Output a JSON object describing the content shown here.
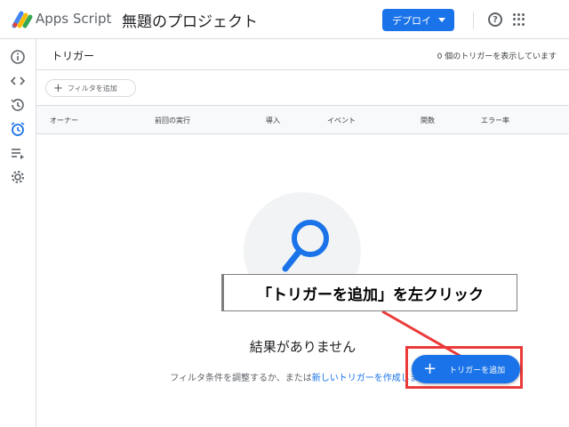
{
  "header": {
    "app_name": "Apps Script",
    "project_name": "無題のプロジェクト",
    "deploy_label": "デプロイ",
    "help_glyph": "?"
  },
  "sidebar": {
    "items": [
      {
        "name": "overview",
        "icon": "info-icon"
      },
      {
        "name": "editor",
        "icon": "code-icon"
      },
      {
        "name": "executions",
        "icon": "history-icon"
      },
      {
        "name": "triggers",
        "icon": "alarm-icon",
        "active": true
      },
      {
        "name": "executions-log",
        "icon": "playlist-icon"
      },
      {
        "name": "settings",
        "icon": "gear-icon"
      }
    ]
  },
  "page": {
    "title": "トリガー",
    "count_text": "0 個のトリガーを表示しています",
    "filter_label": "フィルタを追加",
    "columns": [
      "オーナー",
      "前回の実行",
      "導入",
      "イベント",
      "関数",
      "エラー率"
    ]
  },
  "empty_state": {
    "title": "結果がありません",
    "subtitle_prefix": "フィルタ条件を調整するか、または",
    "subtitle_link": "新しいトリガーを作成します。"
  },
  "fab": {
    "plus": "+",
    "label": "トリガーを追加"
  },
  "annotation": {
    "callout_text": "「トリガーを追加」を左クリック"
  },
  "colors": {
    "accent": "#1a73e8",
    "highlight": "#ea3a3a"
  }
}
